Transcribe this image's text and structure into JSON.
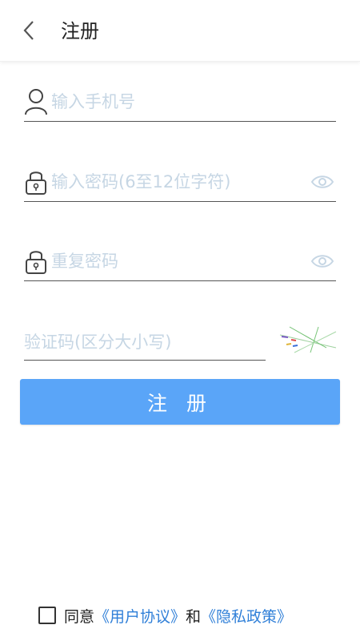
{
  "header": {
    "title": "注册",
    "back_icon": "chevron-left-icon"
  },
  "form": {
    "phone_placeholder": "输入手机号",
    "password_placeholder": "输入密码(6至12位字符)",
    "repeat_password_placeholder": "重复密码",
    "captcha_placeholder": "验证码(区分大小写)",
    "submit_label": "注 册"
  },
  "agreement": {
    "prefix": "同意",
    "user_agreement": "《用户协议》",
    "and": "和",
    "privacy_policy": "《隐私政策》"
  },
  "colors": {
    "accent": "#5aa5f8",
    "link": "#2f7fd8",
    "placeholder": "#c6d6e4"
  }
}
